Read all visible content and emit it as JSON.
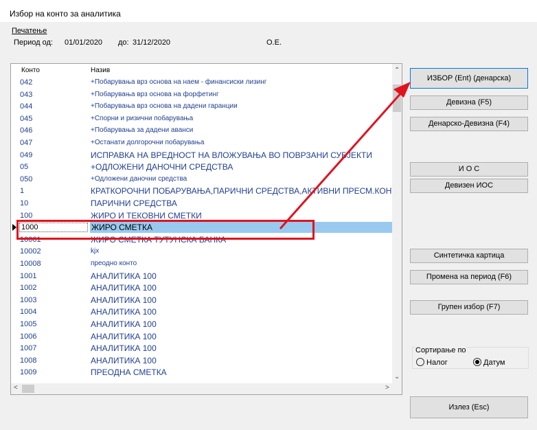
{
  "window": {
    "title": "Избор на конто за аналитика"
  },
  "menu": {
    "print": "Печатење"
  },
  "period": {
    "from_label": "Период од:",
    "from": "01/01/2020",
    "to_label": "до:",
    "to": "31/12/2020",
    "company": "О.Е."
  },
  "grid": {
    "columns": [
      "Конто",
      "Назив"
    ],
    "rows": [
      {
        "code": "042",
        "name": "+Побарувања врз основа на наем - финансиски лизинг"
      },
      {
        "code": "043",
        "name": "+Побарувања врз основа на форфетинг"
      },
      {
        "code": "044",
        "name": "+Побарувања врз основа на дадени гаранции"
      },
      {
        "code": "045",
        "name": "+Спорни и ризични побарувања"
      },
      {
        "code": "046",
        "name": "+Побарувања за дадени аванси"
      },
      {
        "code": "047",
        "name": "+Останати долгорочни побарувања"
      },
      {
        "code": "049",
        "name": "ИСПРАВКА НА ВРЕДНОСТ НА ВЛОЖУВАЊА ВО ПОВРЗАНИ СУБЈЕКТИ"
      },
      {
        "code": "05",
        "name": "+ОДЛОЖЕНИ ДАНОЧНИ СРЕДСТВА"
      },
      {
        "code": "050",
        "name": "+Одложени даночни средства"
      },
      {
        "code": "1",
        "name": "КРАТКОРОЧНИ ПОБАРУВАЊА,ПАРИЧНИ СРЕДСТВА,АКТИВНИ ПРЕСМ.КОНТА"
      },
      {
        "code": "10",
        "name": "ПАРИЧНИ СРЕДСТВА"
      },
      {
        "code": "100",
        "name": "ЖИРО И ТЕКОВНИ СМЕТКИ"
      },
      {
        "code": "1000",
        "name": "ЖИРО СМЕТКА"
      },
      {
        "code": "10001",
        "name": "ЖИРО СМЕТКА ТУТУНСКА БАНКА"
      },
      {
        "code": "10002",
        "name": "kjx"
      },
      {
        "code": "10008",
        "name": "преодно конто"
      },
      {
        "code": "1001",
        "name": "АНАЛИТИКА 100"
      },
      {
        "code": "1002",
        "name": "АНАЛИТИКА 100"
      },
      {
        "code": "1003",
        "name": "АНАЛИТИКА 100"
      },
      {
        "code": "1004",
        "name": "АНАЛИТИКА 100"
      },
      {
        "code": "1005",
        "name": "АНАЛИТИКА 100"
      },
      {
        "code": "1006",
        "name": "АНАЛИТИКА 100"
      },
      {
        "code": "1007",
        "name": "АНАЛИТИКА 100"
      },
      {
        "code": "1008",
        "name": "АНАЛИТИКА 100"
      },
      {
        "code": "1009",
        "name": "ПРЕОДНА СМЕТКА"
      }
    ]
  },
  "buttons": {
    "select": "ИЗБОР (Ent) (денарска)",
    "foreign": "Девизна (F5)",
    "mixed": "Денарско-Девизна (F4)",
    "ios": "И О С",
    "foreign_ios": "Девизен ИОС",
    "synthetic": "Синтетичка картица",
    "change_period": "Промена на период (F6)",
    "group_select": "Групен избор (F7)",
    "exit": "Излез (Esc)"
  },
  "sort": {
    "label": "Сортирање по",
    "option1": "Налог",
    "option2": "Датум",
    "selected": "Датум"
  },
  "colors": {
    "highlight": "#99c9ef",
    "annotation_red": "#e0131e",
    "code_text": "#1f3f8f"
  }
}
